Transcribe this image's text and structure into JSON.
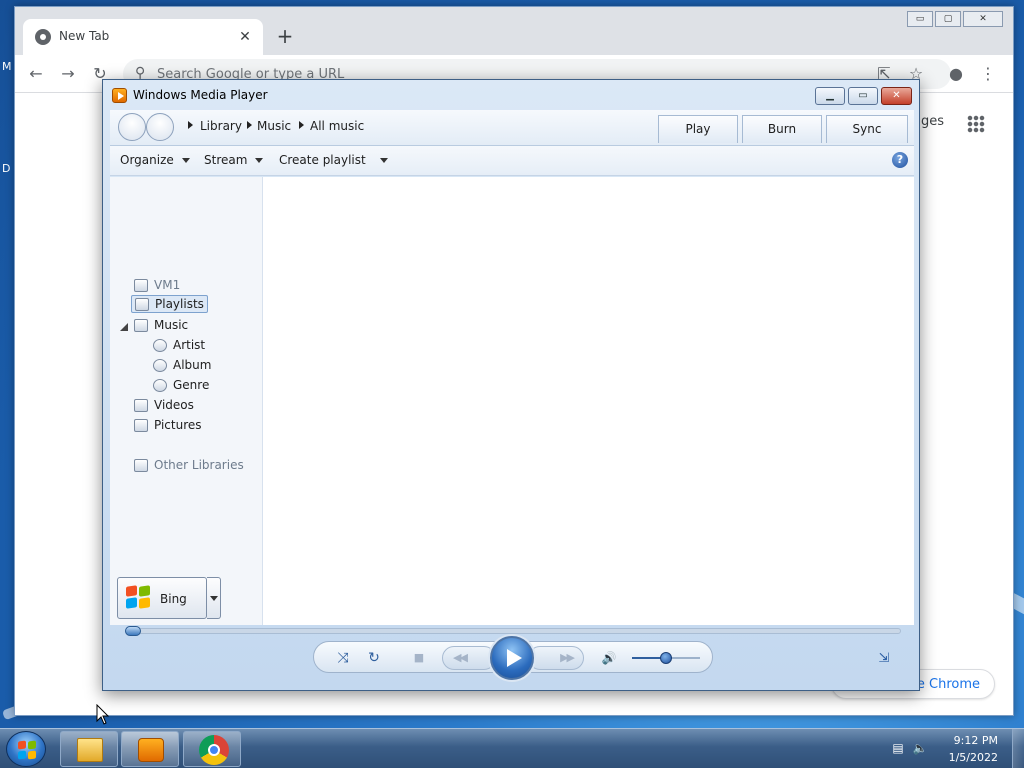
{
  "desktop": {
    "edge_letters": [
      "M",
      "D"
    ]
  },
  "chrome": {
    "tab": {
      "title": "New Tab",
      "close": "✕"
    },
    "new_tab": "+",
    "window_controls": [
      "▭",
      "▢",
      "✕"
    ],
    "toolbar": {
      "back": "←",
      "forward": "→",
      "reload": "↻",
      "share": "⇱",
      "star": "☆",
      "profile": "●",
      "menu": "⋮"
    },
    "omnibox": {
      "icon": "search-icon",
      "placeholder": "Search Google or type a URL"
    },
    "right_text": "ges",
    "customize_label": "e Chrome"
  },
  "wmp": {
    "title": "Windows Media Player",
    "caption_buttons": {
      "minimize": "▁",
      "maximize": "▭",
      "close": "✕"
    },
    "breadcrumb": [
      "Library",
      "Music",
      "All music"
    ],
    "tabs": [
      "Play",
      "Burn",
      "Sync"
    ],
    "command_bar": {
      "organize": "Organize",
      "stream": "Stream",
      "create_playlist": "Create playlist",
      "help": "?"
    },
    "library_tree": {
      "root": "VM1",
      "playlists": "Playlists",
      "music": "Music",
      "music_children": [
        "Artist",
        "Album",
        "Genre"
      ],
      "videos": "Videos",
      "pictures": "Pictures",
      "other_libraries": "Other Libraries"
    },
    "bing_label": "Bing",
    "seek_progress": 0.0,
    "volume_level": 0.5,
    "controls": {
      "shuffle": "⤨",
      "repeat": "↻",
      "stop": "■",
      "previous": "◀◀",
      "next": "▶▶",
      "mute": "🔊",
      "switch_view": "⇲"
    }
  },
  "taskbar": {
    "clock_time": "9:12 PM",
    "clock_date": "1/5/2022",
    "pinned": [
      "file-explorer",
      "windows-media-player",
      "google-chrome"
    ]
  },
  "colors": {
    "desktop_blue": "#2c7ccc",
    "wmp_frame": "#c3d8ef",
    "accent_blue": "#2b6bbd",
    "chrome_tabstrip": "#dee1e6"
  }
}
